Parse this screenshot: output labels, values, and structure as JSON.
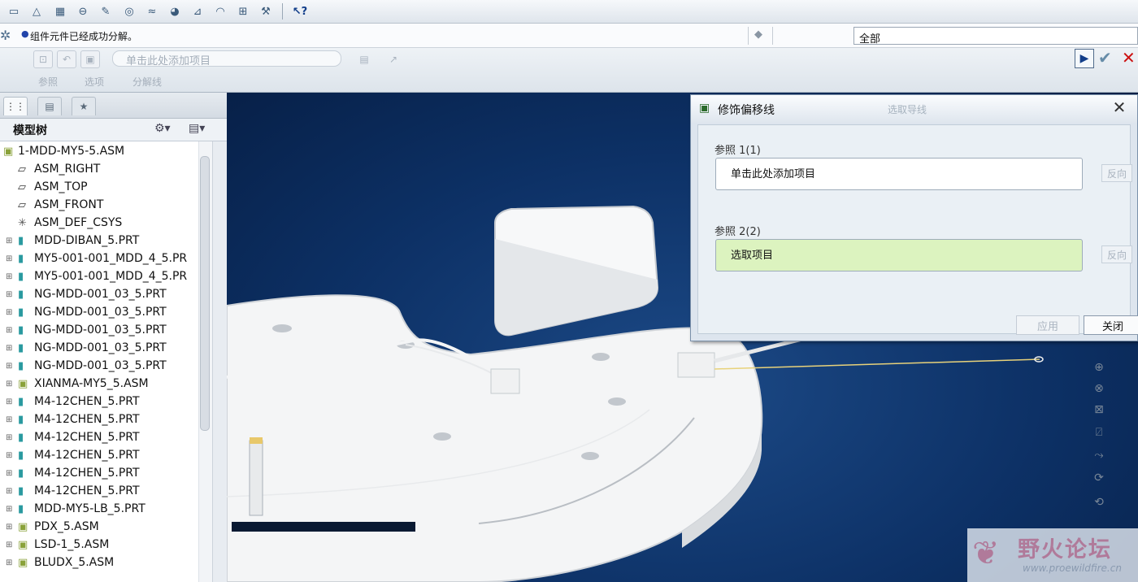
{
  "toolbar": {
    "icons": [
      "dimension-icon",
      "datum-plane-icon",
      "table-icon",
      "note-icon",
      "sketch-icon",
      "surface-icon",
      "cosmetic-icon",
      "appearance-icon",
      "annotation-icon",
      "hatch-icon",
      "scale-icon",
      "tool-icon",
      "context-help-icon"
    ],
    "help_glyph": "?"
  },
  "message": {
    "text": "组件元件已经成功分解。",
    "filter_value": "全部"
  },
  "dashboard": {
    "collector_placeholder": "单击此处添加项目",
    "tabs": [
      "参照",
      "选项",
      "分解线"
    ]
  },
  "model_tree": {
    "title": "模型树",
    "items": [
      {
        "label": "1-MDD-MY5-5.ASM",
        "type": "asm",
        "root": true
      },
      {
        "label": "ASM_RIGHT",
        "type": "plane"
      },
      {
        "label": "ASM_TOP",
        "type": "plane"
      },
      {
        "label": "ASM_FRONT",
        "type": "plane"
      },
      {
        "label": "ASM_DEF_CSYS",
        "type": "csys"
      },
      {
        "label": "MDD-DIBAN_5.PRT",
        "type": "prt"
      },
      {
        "label": "MY5-001-001_MDD_4_5.PR",
        "type": "prt"
      },
      {
        "label": "MY5-001-001_MDD_4_5.PR",
        "type": "prt"
      },
      {
        "label": "NG-MDD-001_03_5.PRT",
        "type": "prt"
      },
      {
        "label": "NG-MDD-001_03_5.PRT",
        "type": "prt"
      },
      {
        "label": "NG-MDD-001_03_5.PRT",
        "type": "prt"
      },
      {
        "label": "NG-MDD-001_03_5.PRT",
        "type": "prt"
      },
      {
        "label": "NG-MDD-001_03_5.PRT",
        "type": "prt"
      },
      {
        "label": "XIANMA-MY5_5.ASM",
        "type": "asm"
      },
      {
        "label": "M4-12CHEN_5.PRT",
        "type": "prt"
      },
      {
        "label": "M4-12CHEN_5.PRT",
        "type": "prt"
      },
      {
        "label": "M4-12CHEN_5.PRT",
        "type": "prt"
      },
      {
        "label": "M4-12CHEN_5.PRT",
        "type": "prt"
      },
      {
        "label": "M4-12CHEN_5.PRT",
        "type": "prt"
      },
      {
        "label": "M4-12CHEN_5.PRT",
        "type": "prt"
      },
      {
        "label": "MDD-MY5-LB_5.PRT",
        "type": "prt"
      },
      {
        "label": "PDX_5.ASM",
        "type": "asm"
      },
      {
        "label": "LSD-1_5.ASM",
        "type": "asm"
      },
      {
        "label": "BLUDX_5.ASM",
        "type": "asm"
      }
    ]
  },
  "dialog": {
    "title": "修饰偏移线",
    "title_ghost": "选取导线",
    "ref1_label": "参照 1(1)",
    "ref1_value": "单击此处添加项目",
    "ref2_label": "参照 2(2)",
    "ref2_value": "选取项目",
    "flip_label": "反向",
    "apply_label": "应用",
    "close_label": "关闭"
  },
  "watermark": {
    "text": "野火论坛",
    "url": "www.proewildfire.cn"
  },
  "colors": {
    "viewport_bg": "#0d3166",
    "active_field": "#dcf3bf",
    "cancel": "#cc1111"
  }
}
